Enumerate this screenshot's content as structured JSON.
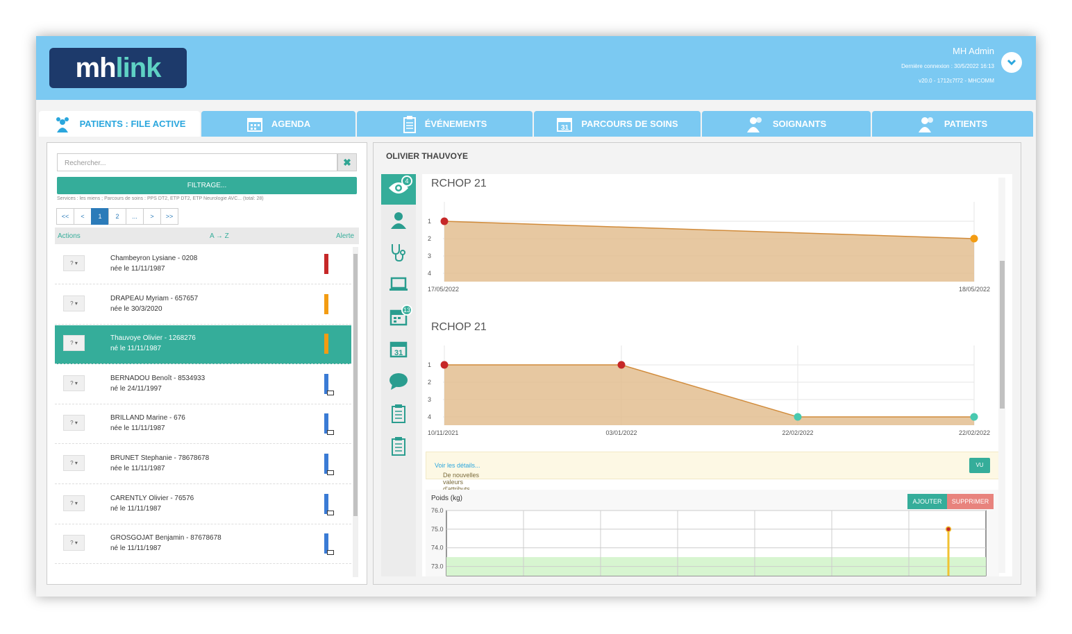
{
  "header": {
    "logo_a": "mh",
    "logo_b": "link",
    "user_name": "MH Admin",
    "last_login": "Dernière connexion : 30/5/2022 16:13",
    "version": "v20.0 - 1712c7f72 - MHCOMM"
  },
  "tabs": [
    {
      "label": "PATIENTS : FILE ACTIVE",
      "icon": "users-icon",
      "active": true
    },
    {
      "label": "AGENDA",
      "icon": "calendar-icon"
    },
    {
      "label": "ÉVÉNEMENTS",
      "icon": "clipboard-icon"
    },
    {
      "label": "PARCOURS DE SOINS",
      "icon": "calendar-31-icon"
    },
    {
      "label": "SOIGNANTS",
      "icon": "users-icon"
    },
    {
      "label": "PATIENTS",
      "icon": "users-icon"
    }
  ],
  "left": {
    "search_placeholder": "Rechercher...",
    "filter_label": "FILTRAGE...",
    "services": "Services : les miens ; Parcours de soins : PPS DT2, ETP DT2, ETP Neurologie AVC... (total: 28)",
    "pagination": [
      "<<",
      "<",
      "1",
      "2",
      "...",
      ">",
      ">>"
    ],
    "col_actions": "Actions",
    "col_sort": "A → Z",
    "col_alert": "Alerte",
    "action_btn": "? ▾",
    "patients": [
      {
        "name": "Chambeyron Lysiane - 0208",
        "birth": "née le 11/11/1987",
        "alert_color": "#c62828",
        "mail": false
      },
      {
        "name": "DRAPEAU Myriam - 657657",
        "birth": "née le 30/3/2020",
        "alert_color": "#f39c12",
        "mail": false
      },
      {
        "name": "Thauvoye Olivier - 1268276",
        "birth": "né le 11/11/1987",
        "alert_color": "#f39c12",
        "mail": false,
        "selected": true
      },
      {
        "name": "BERNADOU Benoît - 8534933",
        "birth": "né le 24/11/1997",
        "alert_color": "#3a7bd5",
        "mail": true
      },
      {
        "name": "BRILLAND Marine - 676",
        "birth": "née le 11/11/1987",
        "alert_color": "#3a7bd5",
        "mail": true
      },
      {
        "name": "BRUNET Stephanie - 78678678",
        "birth": "née le 11/11/1987",
        "alert_color": "#3a7bd5",
        "mail": true
      },
      {
        "name": "CARENTLY Olivier - 76576",
        "birth": "né le 11/11/1987",
        "alert_color": "#3a7bd5",
        "mail": true
      },
      {
        "name": "GROSGOJAT Benjamin - 87678678",
        "birth": "né le 11/11/1987",
        "alert_color": "#3a7bd5",
        "mail": true
      }
    ]
  },
  "right": {
    "patient_name": "OLIVIER THAUVOYE",
    "side_icons": [
      {
        "icon": "eye-icon",
        "badge": "4",
        "active": true
      },
      {
        "icon": "user-icon"
      },
      {
        "icon": "stethoscope-icon"
      },
      {
        "icon": "laptop-icon"
      },
      {
        "icon": "calendar-icon",
        "badge": "13"
      },
      {
        "icon": "calendar-31-icon"
      },
      {
        "icon": "chat-icon"
      },
      {
        "icon": "clipboard-icon"
      },
      {
        "icon": "clipboard-icon"
      }
    ],
    "notif_text": "De nouvelles valeurs d'attributs ont été saisies.",
    "notif_link": "Voir les détails...",
    "vu_label": "VU",
    "poids_label": "Poids (kg)",
    "add_label": "AJOUTER",
    "del_label": "SUPPRIMER"
  },
  "chart_data": [
    {
      "type": "area",
      "title": "RCHOP 21",
      "x": [
        "17/05/2022",
        "18/05/2022"
      ],
      "values": [
        1,
        2
      ],
      "point_colors": [
        "#c62828",
        "#f39c12"
      ],
      "yticks": [
        "1",
        "2",
        "3",
        "4"
      ],
      "ylim": [
        1,
        4
      ]
    },
    {
      "type": "area",
      "title": "RCHOP 21",
      "x": [
        "10/11/2021",
        "03/01/2022",
        "22/02/2022",
        "22/02/2022"
      ],
      "values": [
        1,
        1,
        4,
        4
      ],
      "point_colors": [
        "#c62828",
        "#c62828",
        "#48c9b0",
        "#48c9b0"
      ],
      "yticks": [
        "1",
        "2",
        "3",
        "4"
      ],
      "ylim": [
        1,
        4
      ]
    },
    {
      "type": "line",
      "title": "Poids (kg)",
      "yticks": [
        "76.0",
        "75.0",
        "74.0",
        "73.0"
      ],
      "ylim": [
        72.5,
        76.0
      ],
      "normal_range": [
        72.5,
        73.5
      ],
      "point": 75.0
    }
  ]
}
